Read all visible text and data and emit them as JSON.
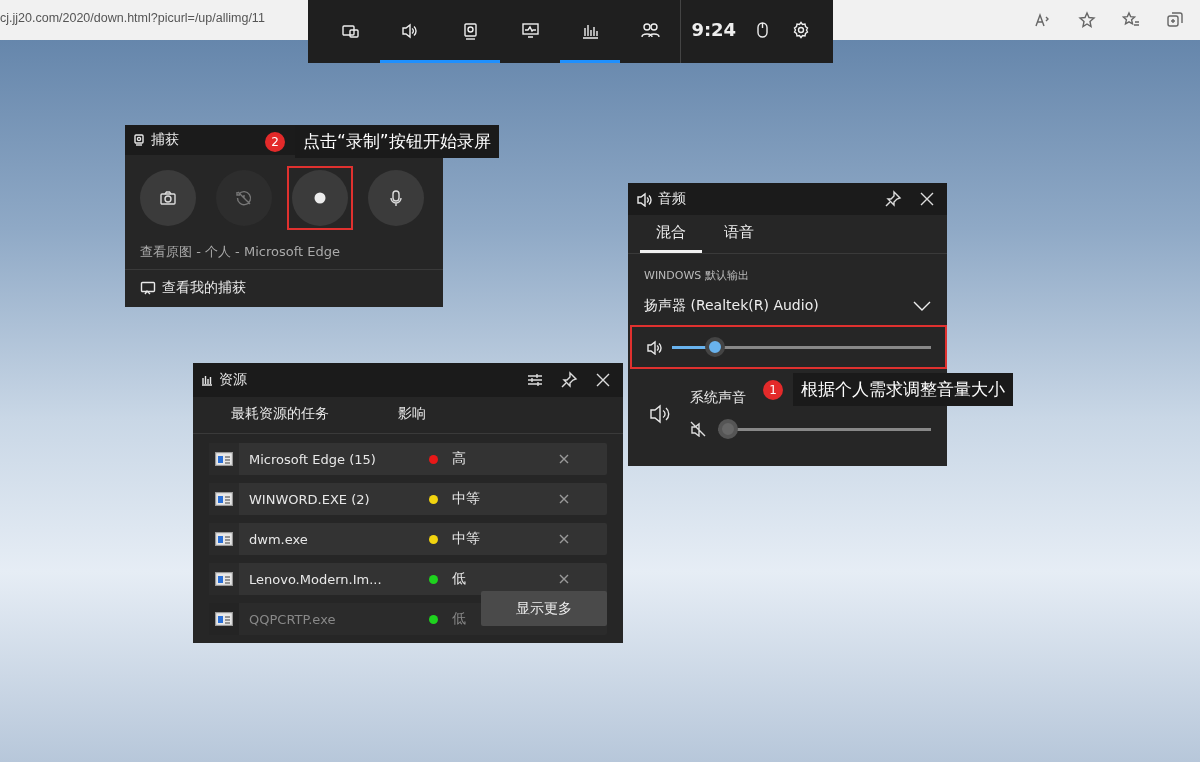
{
  "browser": {
    "address": "cj.jj20.com/2020/down.html?picurl=/up/allimg/11"
  },
  "game_bar": {
    "buttons": [
      {
        "selected": false
      },
      {
        "selected": true
      },
      {
        "selected": true
      },
      {
        "selected": false
      },
      {
        "selected": true
      },
      {
        "selected": false
      }
    ],
    "time": "9:24"
  },
  "capture": {
    "title": "捕获",
    "buttons": [
      {
        "kind": "screenshot",
        "disabled": false,
        "highlighted": false
      },
      {
        "kind": "record-last",
        "disabled": true,
        "highlighted": false
      },
      {
        "kind": "record",
        "disabled": false,
        "highlighted": true
      },
      {
        "kind": "mic",
        "disabled": false,
        "highlighted": false
      }
    ],
    "source": "查看原图 - 个人 - Microsoft Edge",
    "link": "查看我的捕获",
    "annotation": {
      "number": "2",
      "text": "点击“录制”按钮开始录屏"
    }
  },
  "audio": {
    "title": "音频",
    "tabs": [
      {
        "label": "混合",
        "selected": true
      },
      {
        "label": "语音",
        "selected": false
      }
    ],
    "section": "WINDOWS 默认输出",
    "device": "扬声器 (Realtek(R) Audio)",
    "master": {
      "level": 0.14,
      "highlighted": true
    },
    "apps": [
      {
        "name": "系统声音",
        "muted": true,
        "level": 0.0
      }
    ],
    "annotation": {
      "number": "1",
      "text": "根据个人需求调整音量大小"
    }
  },
  "resources": {
    "title": "资源",
    "columns": [
      "最耗资源的任务",
      "影响"
    ],
    "rows": [
      {
        "name": "Microsoft Edge (15)",
        "impact": "高",
        "color": "#e81818"
      },
      {
        "name": "WINWORD.EXE (2)",
        "impact": "中等",
        "color": "#f2d40f"
      },
      {
        "name": "dwm.exe",
        "impact": "中等",
        "color": "#f2d40f"
      },
      {
        "name": "Lenovo.Modern.Im...",
        "impact": "低",
        "color": "#1ed21e"
      },
      {
        "name": "QQPCRTP.exe",
        "impact": "低",
        "color": "#1ed21e"
      }
    ],
    "more": "显示更多"
  }
}
